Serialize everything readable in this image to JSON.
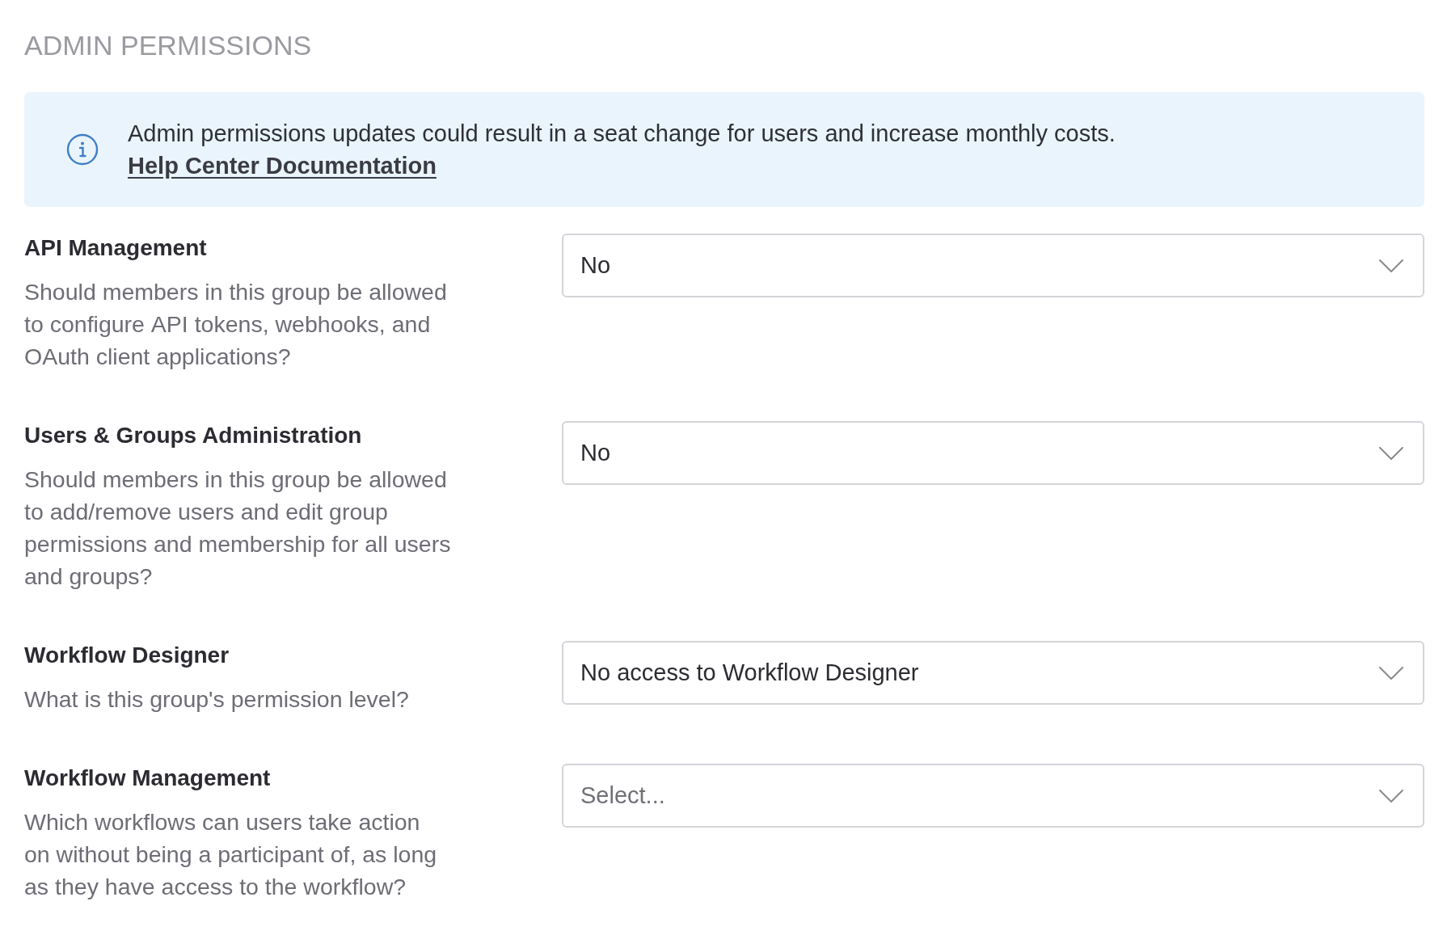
{
  "section": {
    "title": "ADMIN PERMISSIONS"
  },
  "notice": {
    "message": "Admin permissions updates could result in a seat change for users and increase monthly costs.",
    "link": "Help Center Documentation"
  },
  "settings": [
    {
      "label": "API Management",
      "description": "Should members in this group be allowed to configure API tokens, webhooks, and OAuth client applications?",
      "select": {
        "value": "No"
      }
    },
    {
      "label": "Users & Groups Administration",
      "description": "Should members in this group be allowed to add/remove users and edit group permissions and membership for all users and groups?",
      "select": {
        "value": "No"
      }
    },
    {
      "label": "Workflow Designer",
      "description": "What is this group's permission level?",
      "select": {
        "value": "No access to Workflow Designer"
      }
    },
    {
      "label": "Workflow Management",
      "description": "Which workflows can users take action on without being a participant of, as long as they have access to the workflow?",
      "select": {
        "placeholder": "Select..."
      }
    }
  ]
}
